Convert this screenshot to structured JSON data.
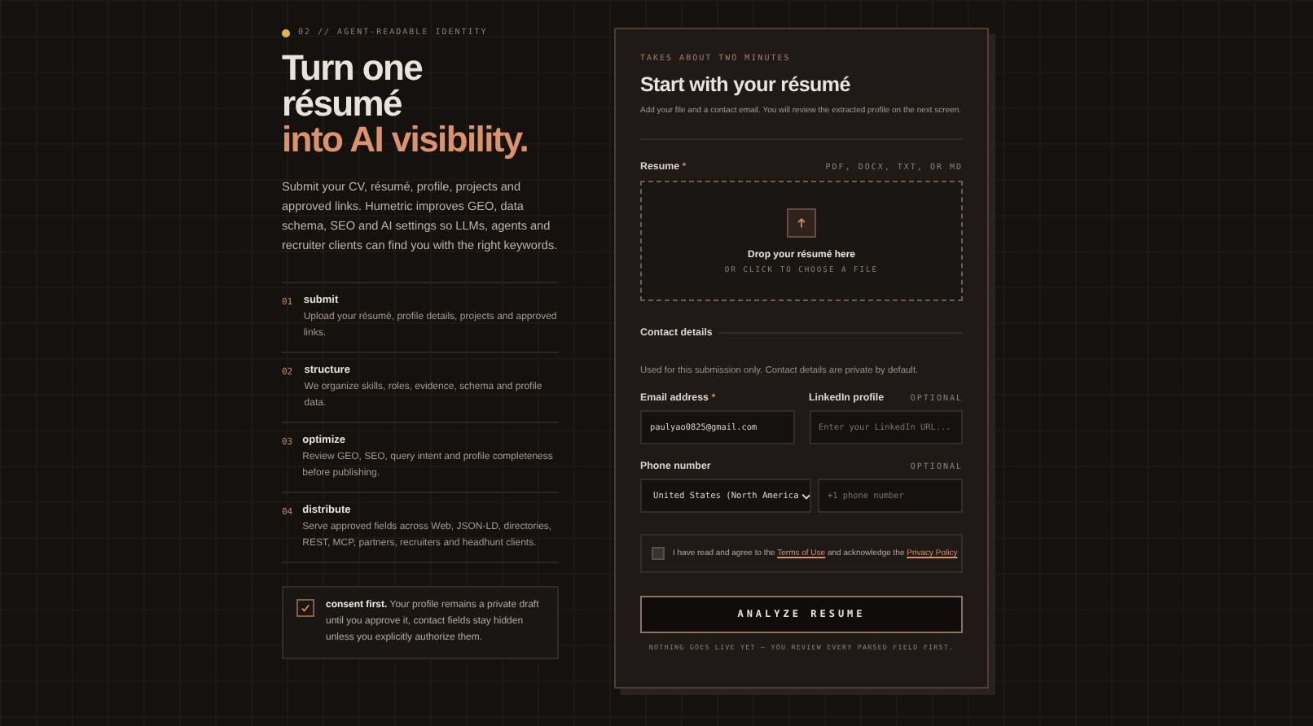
{
  "hero": {
    "eyebrow": "02 // AGENT-READABLE IDENTITY",
    "headline_lines": [
      "Turn one",
      "résumé"
    ],
    "headline_accent": "into AI visibility.",
    "intro": "Submit your CV, résumé, profile, projects and approved links. Humetric improves GEO, data schema, SEO and AI settings so LLMs, agents and recruiter clients can find you with the right keywords."
  },
  "steps": [
    {
      "number": "01",
      "title": "submit",
      "text": "Upload your résumé, profile details, projects and approved links."
    },
    {
      "number": "02",
      "title": "structure",
      "text": "We organize skills, roles, evidence, schema and profile data."
    },
    {
      "number": "03",
      "title": "optimize",
      "text": "Review GEO, SEO, query intent and profile completeness before publishing."
    },
    {
      "number": "04",
      "title": "distribute",
      "text": "Serve approved fields across Web, JSON-LD, directories, REST, MCP, partners, recruiters and headhunt clients."
    }
  ],
  "consent": {
    "checked": true,
    "text": "**consent first.** Your profile remains a private draft until you approve it, contact fields stay hidden unless you explicitly authorize them."
  },
  "form": {
    "eyebrow": "TAKES ABOUT TWO MINUTES",
    "title": "Start with your résumé",
    "subtitle": "Add your file and a contact email. You will review the extracted profile on the next screen.",
    "resume_label": "Resume",
    "required_mark": "*",
    "formats": "PDF, DOCX, TXT, OR MD",
    "drop_title": "Drop your résumé here",
    "drop_hint": "OR CLICK TO CHOOSE A FILE",
    "contact_heading": "Contact details",
    "contact_note": "Used for this submission only. Contact details are private by default.",
    "email": {
      "label": "Email address",
      "value": "paulyao0825@gmail.com"
    },
    "linkedin": {
      "label": "LinkedIn profile",
      "optional": "OPTIONAL",
      "placeholder": "Enter your LinkedIn URL..."
    },
    "phone": {
      "label": "Phone number",
      "optional": "OPTIONAL",
      "country": "United States (North America",
      "placeholder": "+1 phone number"
    },
    "agreement": {
      "checked": false,
      "before": "I have read and agree to the",
      "terms_link": "Terms of Use",
      "middle": "and acknowledge the",
      "privacy_link": "Privacy Policy"
    },
    "submit": "ANALYZE RESUME",
    "footnote": "NOTHING GOES LIVE YET — YOU REVIEW EVERY PARSED FIELD FIRST."
  }
}
